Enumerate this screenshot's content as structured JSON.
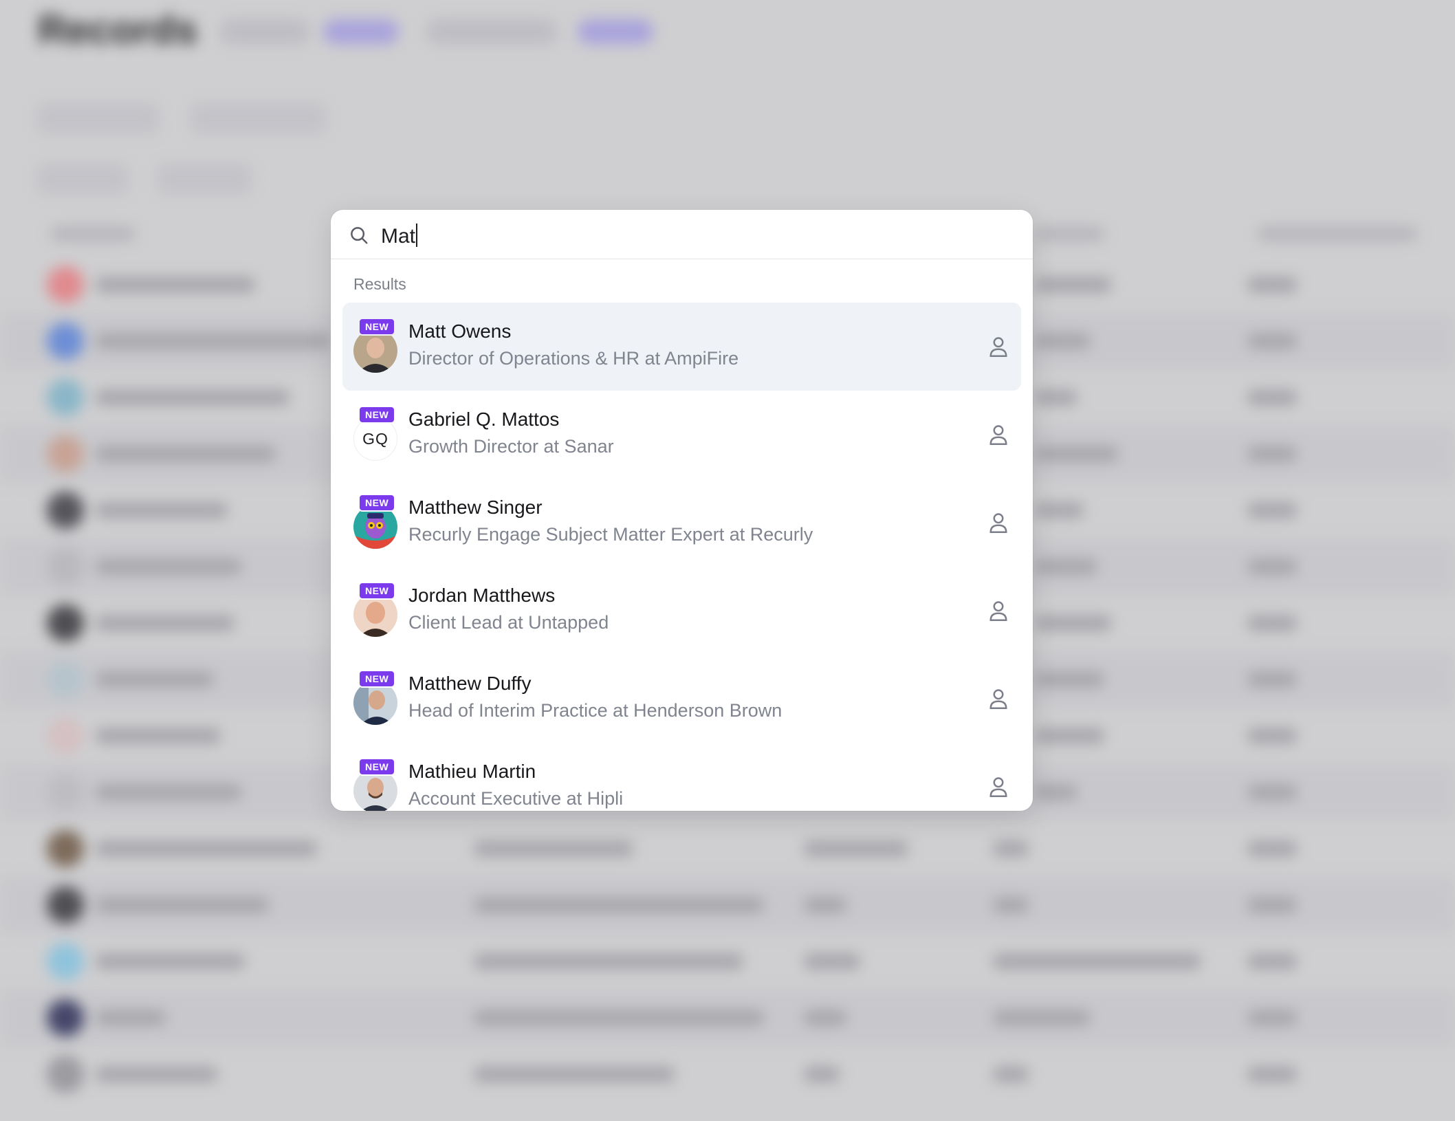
{
  "background": {
    "page_title": "Records"
  },
  "search": {
    "value": "Mat",
    "placeholder": ""
  },
  "results_label": "Results",
  "badge_label": "NEW",
  "results": [
    {
      "name": "Matt Owens",
      "subtitle": "Director of Operations & HR at AmpiFire",
      "badge": true,
      "avatar": "photo",
      "active": true
    },
    {
      "name": "Gabriel Q. Mattos",
      "subtitle": "Growth Director at Sanar",
      "badge": true,
      "avatar": "initials",
      "initials": "GQ",
      "active": false
    },
    {
      "name": "Matthew Singer",
      "subtitle": "Recurly Engage Subject Matter Expert at Recurly",
      "badge": true,
      "avatar": "photo",
      "active": false
    },
    {
      "name": "Jordan Matthews",
      "subtitle": "Client Lead at Untapped",
      "badge": true,
      "avatar": "photo",
      "active": false
    },
    {
      "name": "Matthew Duffy",
      "subtitle": "Head of Interim Practice at Henderson Brown",
      "badge": true,
      "avatar": "photo",
      "active": false
    },
    {
      "name": "Mathieu Martin",
      "subtitle": "Account Executive at Hipli",
      "badge": true,
      "avatar": "photo",
      "active": false
    }
  ],
  "icons": {
    "search": "search-icon",
    "result_type": "person-icon"
  },
  "colors": {
    "badge": "#7c3aed",
    "active_row": "#eff2f7",
    "subtitle": "#80848f",
    "overlay": "#cfcfd1"
  }
}
